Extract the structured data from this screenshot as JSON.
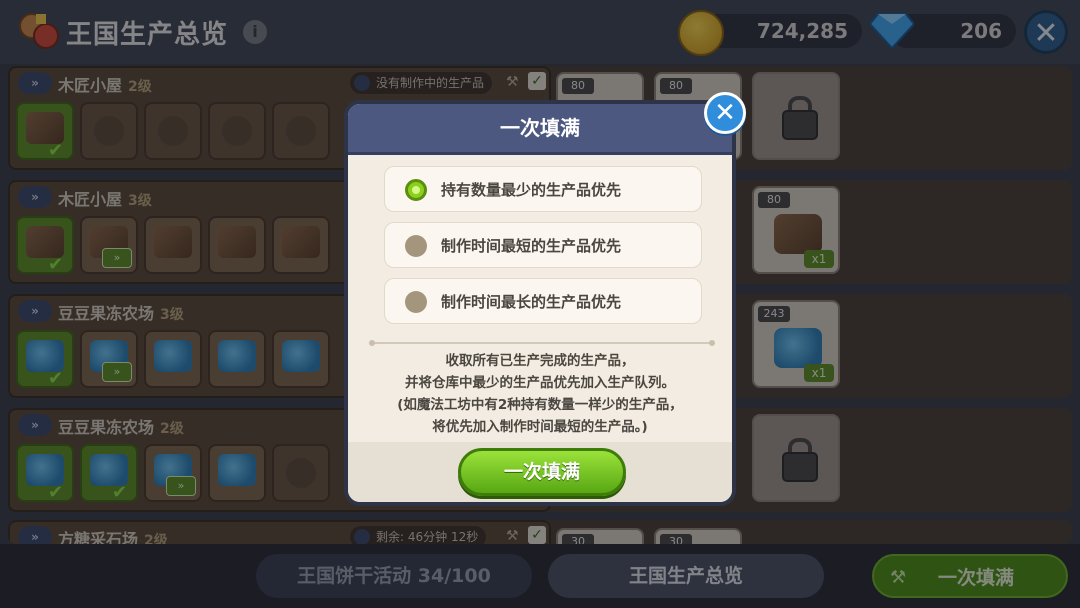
{
  "header": {
    "title": "王国生产总览",
    "info": "i",
    "coins": "724,285",
    "gems": "206",
    "close": "✕"
  },
  "rows": [
    {
      "name": "木匠小屋",
      "level": "2级",
      "status": "没有制作中的生产品",
      "stock_counts": [
        "80",
        "80"
      ]
    },
    {
      "name": "木匠小屋",
      "level": "3级",
      "stock_counts": [
        "80"
      ],
      "stock_badge": "x1"
    },
    {
      "name": "豆豆果冻农场",
      "level": "3级",
      "stock_counts": [
        "243"
      ],
      "stock_badge": "x1"
    },
    {
      "name": "豆豆果冻农场",
      "level": "2级"
    },
    {
      "name": "方糖采石场",
      "level": "2级",
      "status": "剩余: 46分钟 12秒",
      "stock_counts": [
        "30",
        "30"
      ]
    }
  ],
  "footer": {
    "event_label": "王国饼干活动 34/100",
    "overview_label": "王国生产总览",
    "fill_label": "一次填满"
  },
  "modal": {
    "title": "一次填满",
    "close": "✕",
    "options": [
      {
        "label": "持有数量最少的生产品优先",
        "selected": true
      },
      {
        "label": "制作时间最短的生产品优先",
        "selected": false
      },
      {
        "label": "制作时间最长的生产品优先",
        "selected": false
      }
    ],
    "description": [
      "收取所有已生产完成的生产品，",
      "并将仓库中最少的生产品优先加入生产队列。",
      "(如魔法工坊中有2种持有数量一样少的生产品，",
      "将优先加入制作时间最短的生产品。)"
    ],
    "confirm_label": "一次填满"
  },
  "colors": {
    "accent_green": "#8bd01d",
    "modal_header": "#4c5880",
    "close_blue": "#2f8ddb"
  }
}
